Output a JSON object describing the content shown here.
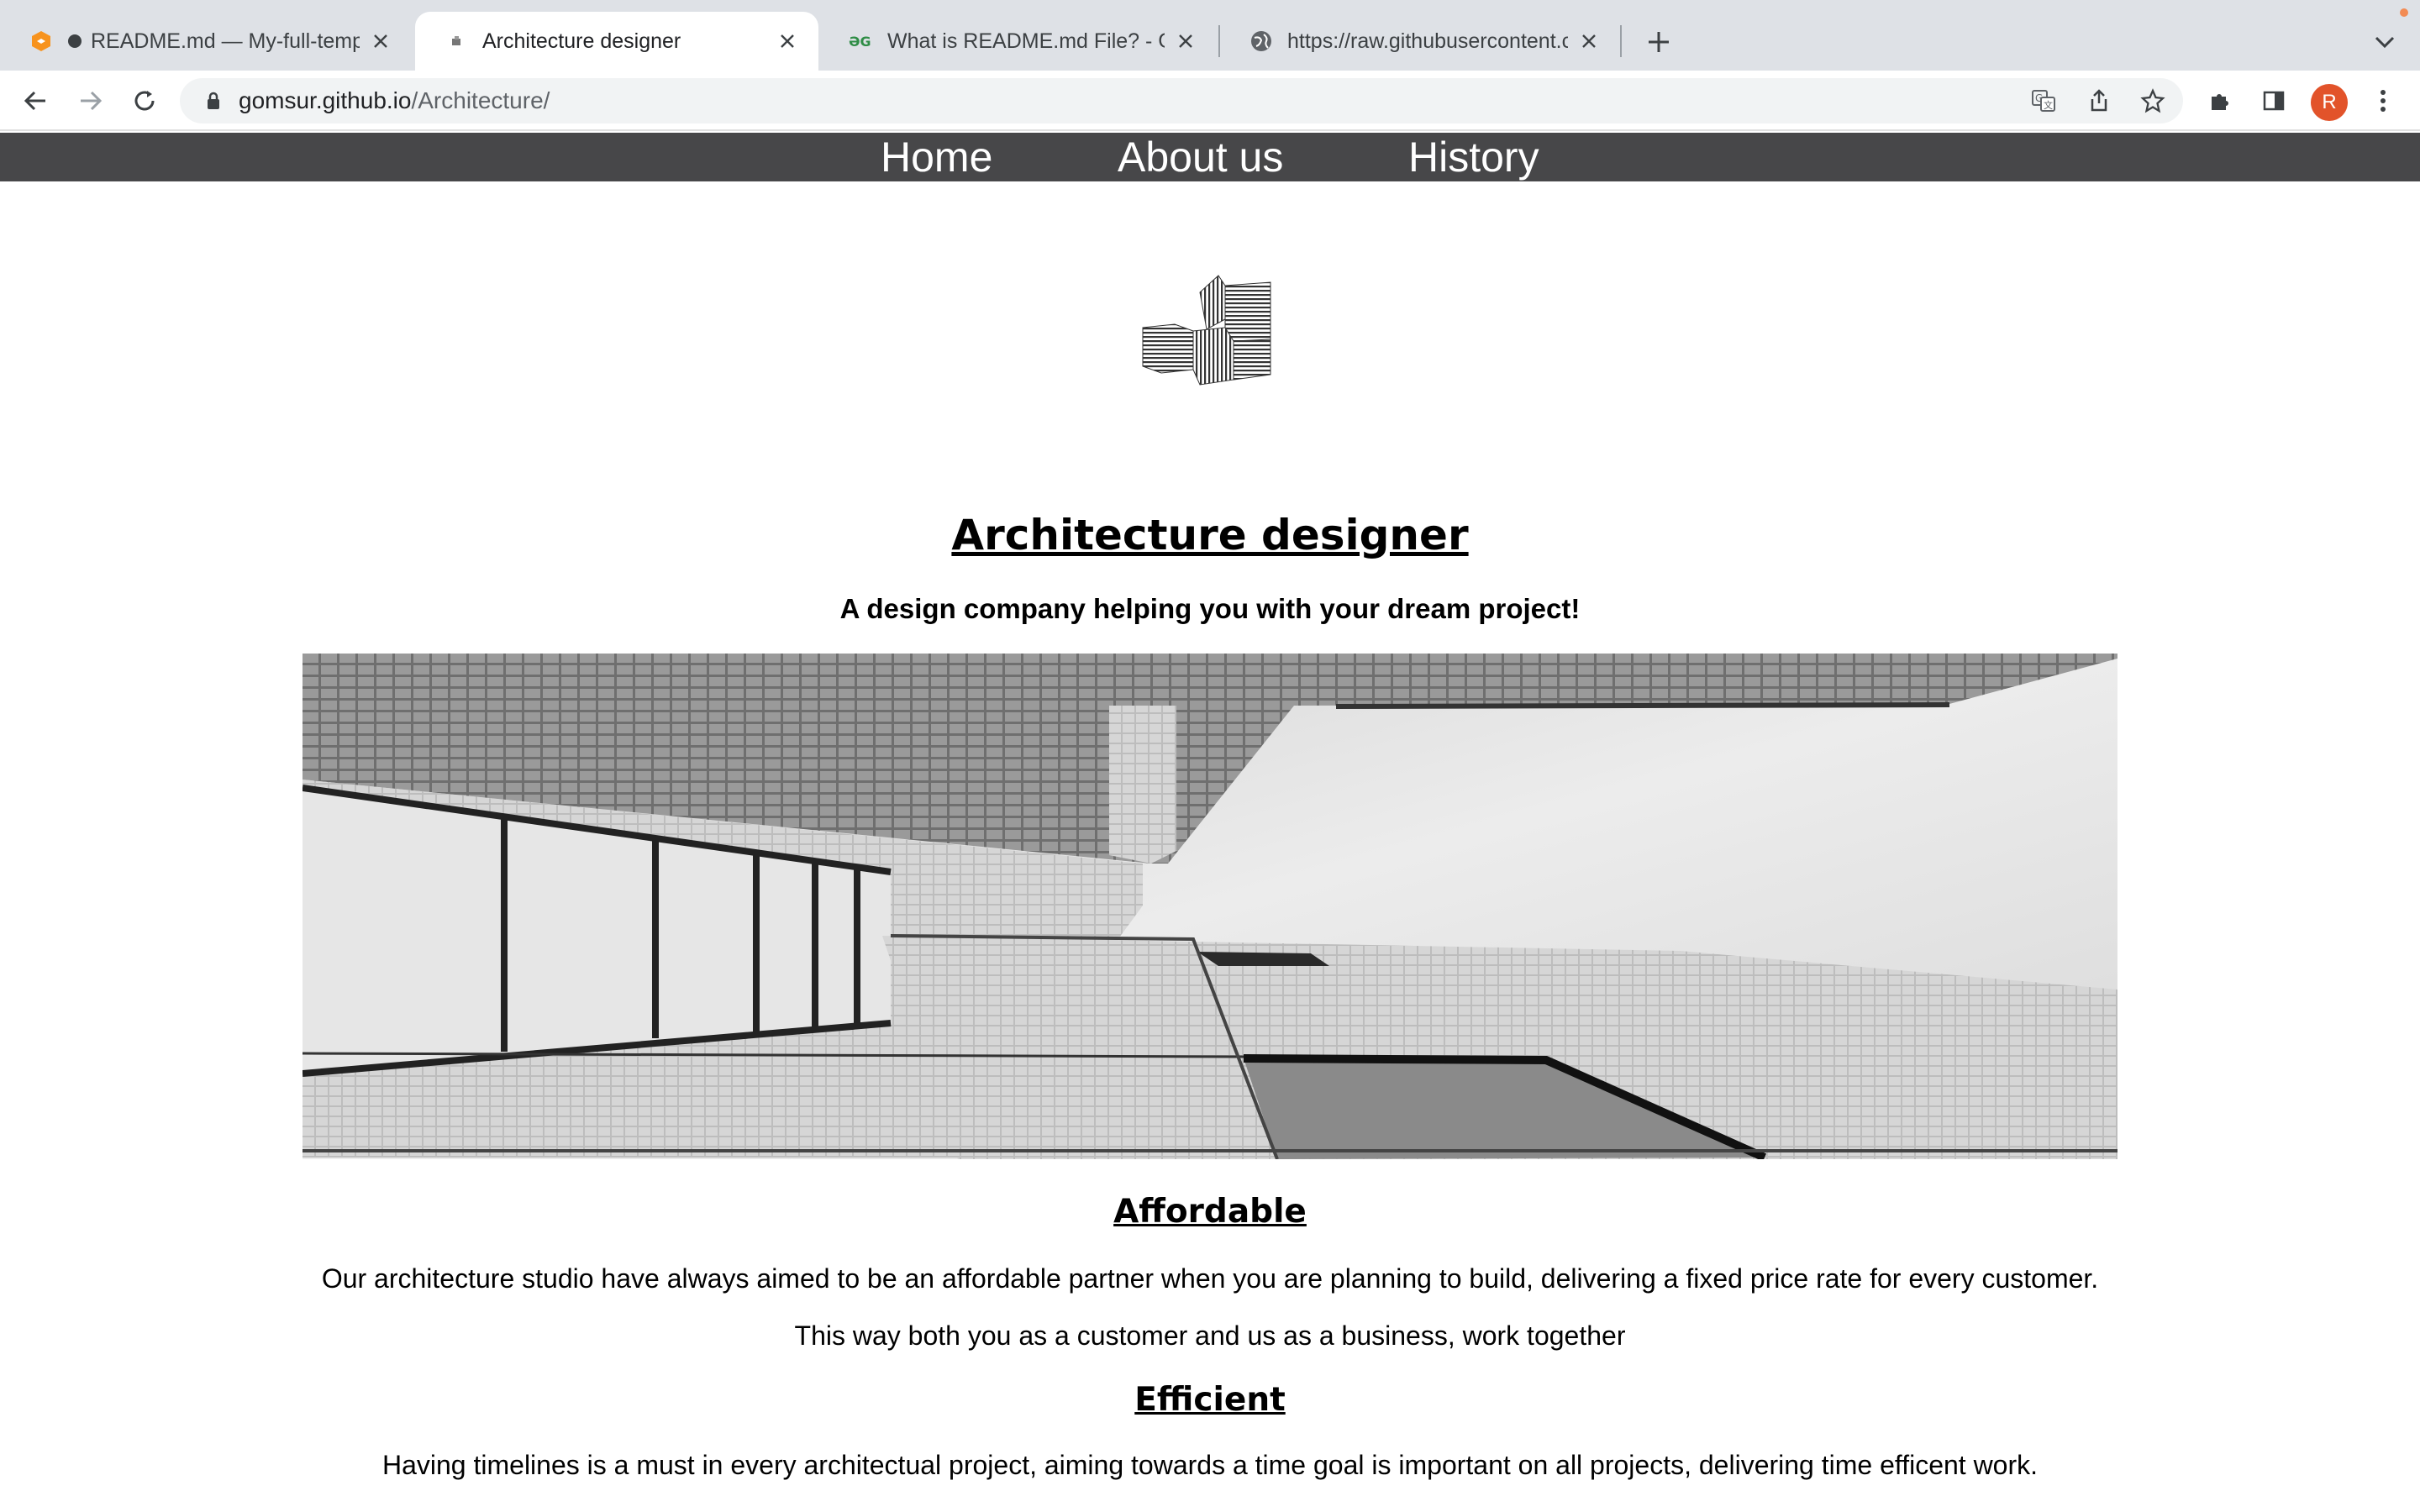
{
  "browser": {
    "tabs": [
      {
        "title": "README.md — My-full-temp",
        "icon": "gitbook-icon"
      },
      {
        "title": "Architecture designer",
        "icon": "site-favicon"
      },
      {
        "title": "What is README.md File? - Ge",
        "icon": "geeksforgeeks-icon"
      },
      {
        "title": "https://raw.githubusercontent.c",
        "icon": "globe-icon"
      }
    ],
    "url_host": "gomsur.github.io",
    "url_path": "/Architecture/",
    "profile_initial": "R",
    "accent_color": "#e2532a"
  },
  "nav": {
    "items": [
      "Home",
      "About us",
      "History"
    ],
    "background": "#474749"
  },
  "page": {
    "title": "Architecture designer",
    "tagline": "A design company helping you with your dream project!",
    "hero_alt": "black and white upward view of a modern building",
    "sections": [
      {
        "heading": "Affordable",
        "paragraphs": [
          "Our architecture studio have always aimed to be an affordable partner when you are planning to build, delivering a fixed price rate for every customer.",
          "This way both you as a customer and us as a business, work together"
        ]
      },
      {
        "heading": "Efficient",
        "paragraphs": [
          "Having timelines is a must in every architectual project, aiming towards a time goal is important on all projects, delivering time efficent work."
        ]
      }
    ]
  }
}
